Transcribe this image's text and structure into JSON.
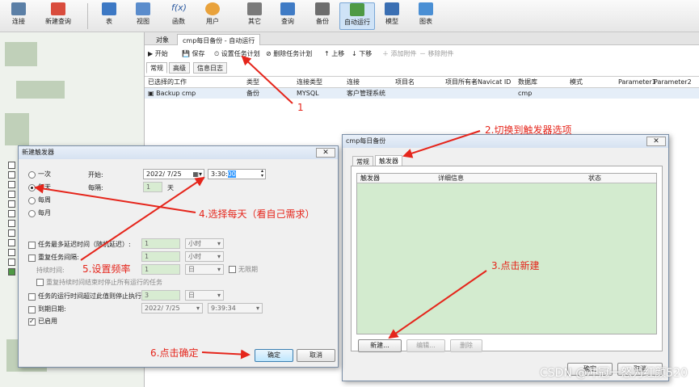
{
  "toolbar": {
    "items": [
      {
        "label": "连接",
        "icon": "connection-icon"
      },
      {
        "label": "新建查询",
        "icon": "new-query-icon"
      },
      {
        "label": "表",
        "icon": "table-icon"
      },
      {
        "label": "视图",
        "icon": "view-icon"
      },
      {
        "label": "函数",
        "icon": "function-icon"
      },
      {
        "label": "用户",
        "icon": "user-icon"
      },
      {
        "label": "其它",
        "icon": "tools-icon"
      },
      {
        "label": "查询",
        "icon": "query-icon"
      },
      {
        "label": "备份",
        "icon": "backup-icon"
      },
      {
        "label": "自动运行",
        "icon": "automation-icon"
      },
      {
        "label": "模型",
        "icon": "model-icon"
      },
      {
        "label": "图表",
        "icon": "chart-icon"
      }
    ]
  },
  "main": {
    "tabs": {
      "objects": "对象",
      "current": "cmp每日备份 - 自动运行"
    },
    "actions": {
      "start": "开始",
      "save": "保存",
      "set_schedule": "设置任务计划",
      "delete_schedule": "删除任务计划",
      "move_up": "上移",
      "move_down": "下移",
      "add_attachment": "添加附件",
      "remove_attachment": "移除附件"
    },
    "subtabs": {
      "general": "常规",
      "advanced": "高级",
      "log": "信息日志"
    },
    "columns": [
      "已选择的工作",
      "类型",
      "连接类型",
      "连接",
      "项目名",
      "项目所有者",
      "Navicat ID",
      "数据库",
      "模式",
      "Parameter1",
      "Parameter2"
    ],
    "row": {
      "job": "Backup cmp",
      "type": "备份",
      "conn_type": "MYSQL",
      "conn": "客户管理系统",
      "database": "cmp"
    }
  },
  "trigger_dialog": {
    "title": "新建触发器",
    "close": "✕",
    "freq": {
      "once": "一次",
      "daily": "每天",
      "weekly": "每周",
      "monthly": "每月",
      "selected": "每天"
    },
    "start_label": "开始:",
    "start_date": "2022/ 7/25",
    "start_time_prefix": "3:30:",
    "start_time_sel": "00",
    "every_label": "每隔:",
    "every_value": "1",
    "every_unit": "天",
    "delay_label": "任务最多延迟时间（随机延迟）:",
    "delay_value": "1",
    "delay_unit": "小时",
    "repeat_label": "重复任务间隔:",
    "repeat_value": "1",
    "repeat_unit": "小时",
    "duration_label": "持续时间:",
    "duration_value": "1",
    "duration_unit": "日",
    "no_limit": "无限期",
    "stop_all_label": "重复持续时间结束时停止所有运行的任务",
    "stop_if_label": "任务的运行时间超过此值则停止执行:",
    "stop_if_value": "3",
    "stop_if_unit": "日",
    "expire_label": "到期日期:",
    "expire_date": "2022/ 7/25",
    "expire_time": "9:39:34",
    "enabled_label": "已启用",
    "ok": "确定",
    "cancel": "取消"
  },
  "schedule_dialog": {
    "title": "cmp每日备份",
    "close": "✕",
    "tabs": {
      "general": "常规",
      "trigger": "触发器"
    },
    "columns": {
      "trigger": "触发器",
      "detail": "详细信息",
      "status": "状态"
    },
    "buttons": {
      "new": "新建...",
      "edit": "编辑...",
      "delete": "删除"
    },
    "footer": {
      "ok": "确定",
      "cancel": "取消"
    }
  },
  "annotations": {
    "a1": "1",
    "a2": "2.切换到触发器选项",
    "a3": "3.点击新建",
    "a4": "4.选择每天（看自己需求）",
    "a5": "5.设置频率",
    "a6": "6.点击确定"
  },
  "watermark": "CSDN @冲冠一怒为红颜520"
}
